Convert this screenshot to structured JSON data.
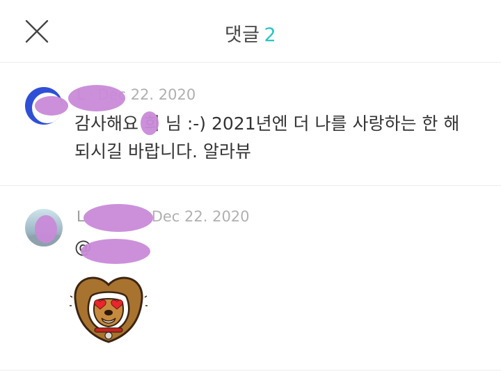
{
  "header": {
    "title": "댓글",
    "count": "2"
  },
  "comments": [
    {
      "author": "L",
      "date": "Dec 22. 2020",
      "text_line1": "감사해요 희 님 :-) 2021년엔 더 나를 사랑하는 한 해",
      "text_line2": "되시길 바랍니다. 알라뷰"
    },
    {
      "author": "L",
      "date": "Dec 22. 2020",
      "mention": "@",
      "sticker": "dog-heart-eyes-sticker"
    }
  ],
  "colors": {
    "accent": "#2cc3c8",
    "redaction": "#c98ad8"
  }
}
